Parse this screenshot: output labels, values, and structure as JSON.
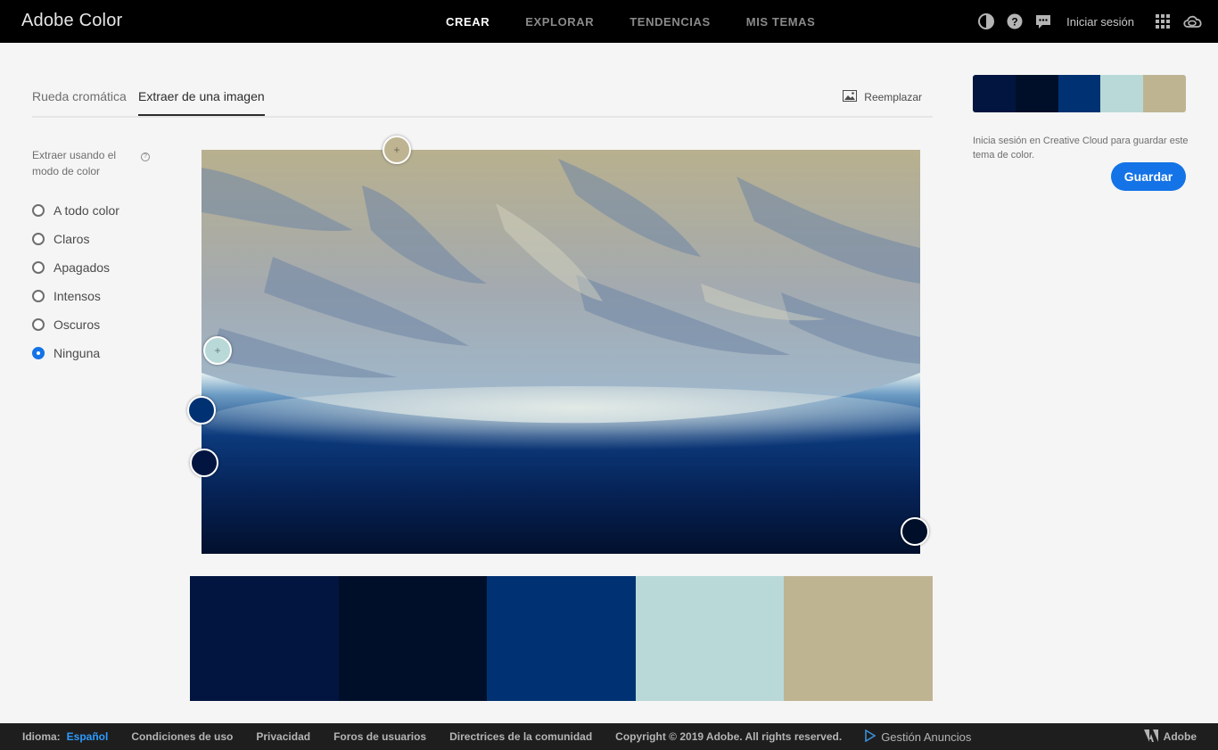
{
  "app": {
    "brand": "Adobe Color"
  },
  "nav": {
    "items": [
      {
        "label": "CREAR",
        "active": true
      },
      {
        "label": "EXPLORAR",
        "active": false
      },
      {
        "label": "TENDENCIAS",
        "active": false
      },
      {
        "label": "MIS TEMAS",
        "active": false
      }
    ]
  },
  "topbar": {
    "signin": "Iniciar sesión",
    "icons": [
      "contrast-icon",
      "help-icon",
      "chat-icon",
      "apps-grid-icon",
      "creative-cloud-icon"
    ]
  },
  "tabs": {
    "wheel": "Rueda cromática",
    "extract": "Extraer de una imagen",
    "replace": "Reemplazar"
  },
  "options": {
    "heading": "Extraer usando el modo de color",
    "info": "?",
    "items": [
      {
        "label": "A todo color",
        "checked": false
      },
      {
        "label": "Claros",
        "checked": false
      },
      {
        "label": "Apagados",
        "checked": false
      },
      {
        "label": "Intensos",
        "checked": false
      },
      {
        "label": "Oscuros",
        "checked": false
      },
      {
        "label": "Ninguna",
        "checked": true
      }
    ]
  },
  "theme": {
    "colors": [
      "#011540",
      "#000F29",
      "#003273",
      "#B8D9D8",
      "#BFB492"
    ],
    "samplers": [
      {
        "color": "#BFB492",
        "plus": "+"
      },
      {
        "color": "#B8D9D8",
        "plus": "+"
      },
      {
        "color": "#003273",
        "plus": ""
      },
      {
        "color": "#011540",
        "plus": ""
      },
      {
        "color": "#000F29",
        "plus": ""
      }
    ]
  },
  "save": {
    "note": "Inicia sesión en Creative Cloud para guardar este tema de color.",
    "button": "Guardar"
  },
  "footer": {
    "lang_label": "Idioma:",
    "lang": "Español",
    "links": [
      "Condiciones de uso",
      "Privacidad",
      "Foros de usuarios",
      "Directrices de la comunidad"
    ],
    "copyright": "Copyright © 2019 Adobe. All rights reserved.",
    "ads": "Gestión Anuncios",
    "adobe": "Adobe"
  }
}
